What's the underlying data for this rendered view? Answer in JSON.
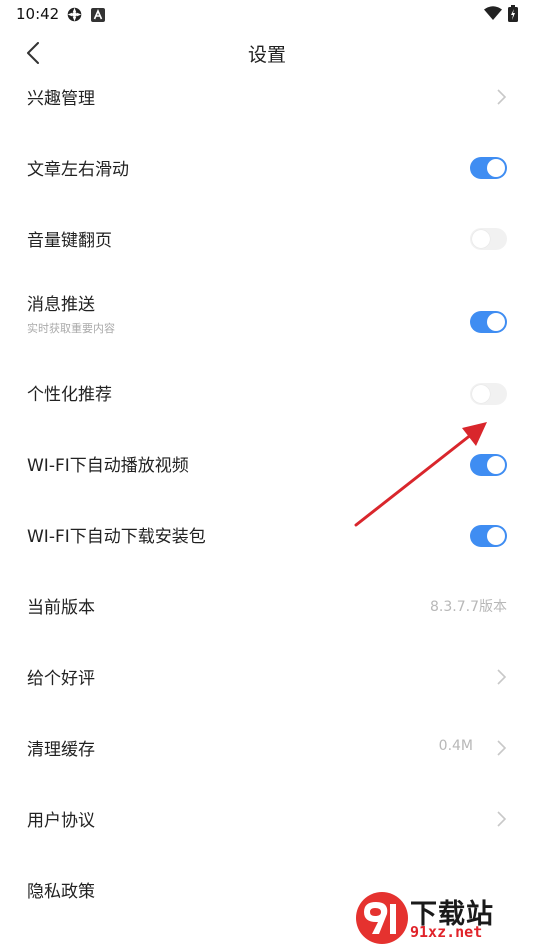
{
  "status_bar": {
    "time": "10:42",
    "icons": [
      "settings-icon",
      "a-icon",
      "wifi-icon",
      "battery-icon"
    ]
  },
  "nav": {
    "title": "设置",
    "back_icon": "chevron-left-icon"
  },
  "settings": [
    {
      "label": "兴趣管理",
      "control": "chevron"
    },
    {
      "label": "文章左右滑动",
      "control": "toggle",
      "state": "on"
    },
    {
      "label": "音量键翻页",
      "control": "toggle",
      "state": "off"
    },
    {
      "label": "消息推送",
      "sublabel": "实时获取重要内容",
      "control": "toggle",
      "state": "on"
    },
    {
      "label": "个性化推荐",
      "control": "toggle",
      "state": "off"
    },
    {
      "label": "WI-FI下自动播放视频",
      "control": "toggle",
      "state": "on"
    },
    {
      "label": "WI-FI下自动下载安装包",
      "control": "toggle",
      "state": "on"
    },
    {
      "label": "当前版本",
      "control": "value",
      "value": "8.3.7.7版本"
    },
    {
      "label": "给个好评",
      "control": "chevron"
    },
    {
      "label": "清理缓存",
      "control": "value-chevron",
      "value": "0.4M"
    },
    {
      "label": "用户协议",
      "control": "chevron"
    },
    {
      "label": "隐私政策",
      "control": "none"
    }
  ],
  "watermark": {
    "top_text": "下载站",
    "bottom_text": "91xz.net"
  },
  "colors": {
    "toggle_on": "#3f8df2",
    "toggle_off": "#f1f1f1",
    "annotation_arrow": "#d9262c"
  }
}
